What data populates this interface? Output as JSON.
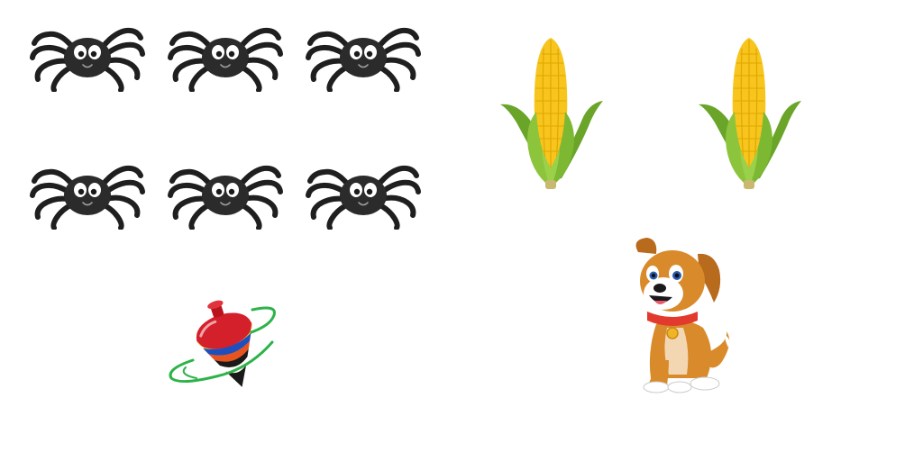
{
  "scene": {
    "background": "#ffffff",
    "groups": [
      {
        "name": "spiders",
        "count": 6,
        "icon": "spider-icon"
      },
      {
        "name": "corn",
        "count": 2,
        "icon": "corn-icon"
      },
      {
        "name": "spinning-top",
        "count": 1,
        "icon": "spinning-top-icon"
      },
      {
        "name": "puppy",
        "count": 1,
        "icon": "puppy-icon"
      }
    ]
  },
  "colors": {
    "spider_body": "#2b2b2b",
    "corn_kernel": "#f7c51e",
    "corn_husk": "#7cb832",
    "top_red": "#d4202a",
    "top_swirl": "#2db34a",
    "dog_fur": "#d98a2b",
    "dog_collar": "#e23b2e"
  }
}
